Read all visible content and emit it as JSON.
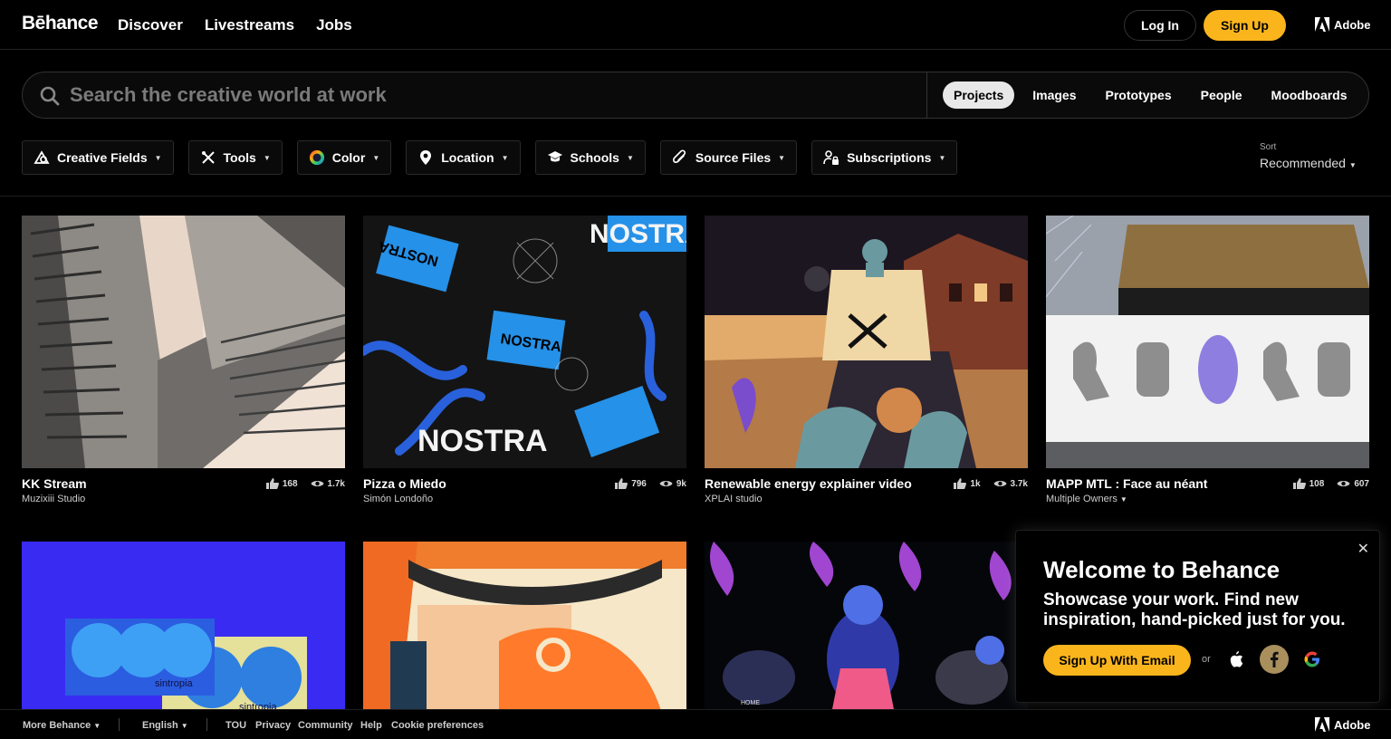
{
  "header": {
    "logo": "Bēhance",
    "nav": [
      "Discover",
      "Livestreams",
      "Jobs"
    ],
    "login_label": "Log In",
    "signup_label": "Sign Up",
    "adobe_label": "Adobe"
  },
  "search": {
    "placeholder": "Search the creative world at work",
    "scopes": [
      "Projects",
      "Images",
      "Prototypes",
      "People",
      "Moodboards"
    ],
    "active_scope": "Projects"
  },
  "filters": [
    "Creative Fields",
    "Tools",
    "Color",
    "Location",
    "Schools",
    "Source Files",
    "Subscriptions"
  ],
  "sort": {
    "label": "Sort",
    "value": "Recommended"
  },
  "projects": [
    {
      "title": "KK Stream",
      "owner": "Muzixiii Studio",
      "likes": "168",
      "views": "1.7k"
    },
    {
      "title": "Pizza o Miedo",
      "owner": "Simón Londoño",
      "likes": "796",
      "views": "9k"
    },
    {
      "title": "Renewable energy explainer video",
      "owner": "XPLAI studio",
      "likes": "1k",
      "views": "3.7k"
    },
    {
      "title": "MAPP MTL : Face au néant",
      "owner": "Multiple Owners",
      "likes": "108",
      "views": "607"
    }
  ],
  "art_text": {
    "nostra": "NOSTRA",
    "sintropia": "sintropia",
    "home": "HOME"
  },
  "welcome": {
    "title": "Welcome to Behance",
    "body": "Showcase your work. Find new inspiration, hand-picked just for you.",
    "email_label": "Sign Up With Email",
    "or_label": "or"
  },
  "footer": {
    "more": "More Behance",
    "language": "English",
    "links": [
      "TOU",
      "Privacy",
      "Community",
      "Help",
      "Cookie preferences"
    ],
    "adobe_label": "Adobe"
  },
  "colors": {
    "accent": "#fbb51c",
    "background": "#000000"
  }
}
